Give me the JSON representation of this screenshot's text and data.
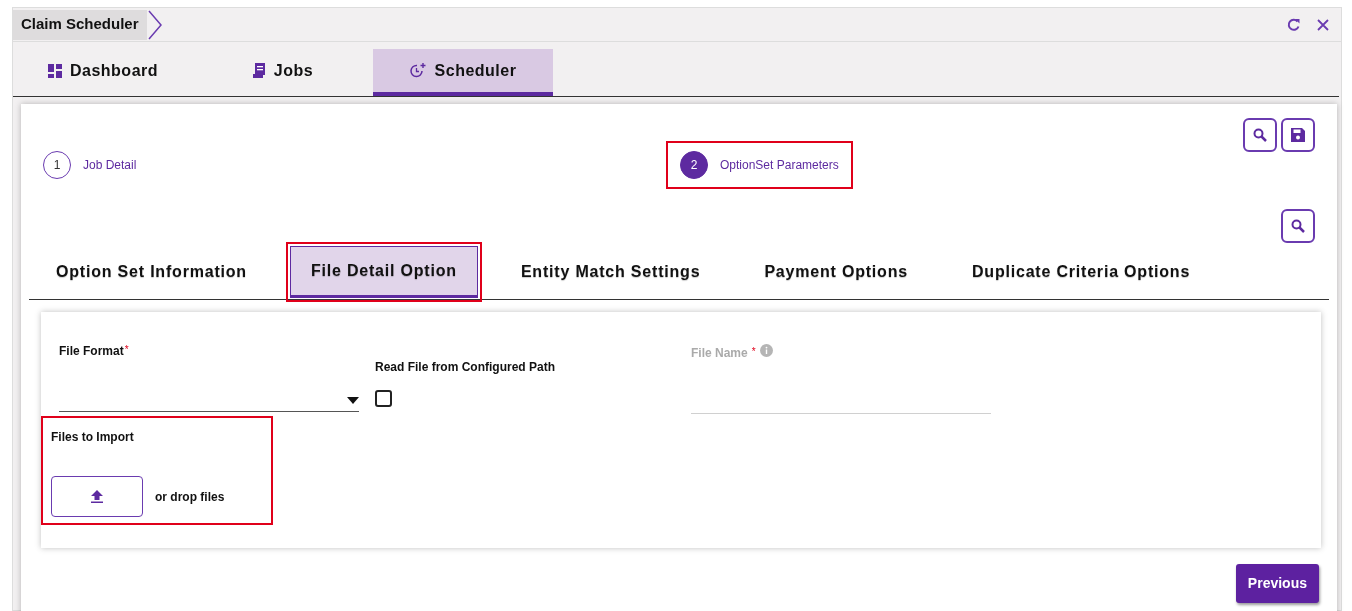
{
  "window": {
    "title": "Claim Scheduler"
  },
  "main_tabs": [
    {
      "label": "Dashboard",
      "selected": false
    },
    {
      "label": "Jobs",
      "selected": false
    },
    {
      "label": "Scheduler",
      "selected": true
    }
  ],
  "steps": [
    {
      "number": "1",
      "label": "Job Detail",
      "selected": false,
      "highlighted": false
    },
    {
      "number": "2",
      "label": "OptionSet Parameters",
      "selected": true,
      "highlighted": true
    }
  ],
  "option_tabs": [
    {
      "label": "Option Set Information",
      "selected": false,
      "highlighted": false
    },
    {
      "label": "File Detail Option",
      "selected": true,
      "highlighted": true
    },
    {
      "label": "Entity Match Settings",
      "selected": false,
      "highlighted": false
    },
    {
      "label": "Payment Options",
      "selected": false,
      "highlighted": false
    },
    {
      "label": "Duplicate Criteria Options",
      "selected": false,
      "highlighted": false
    }
  ],
  "form": {
    "file_format": {
      "label": "File Format",
      "required_mark": "*"
    },
    "read_from_path": {
      "label": "Read File from Configured Path",
      "checked": false
    },
    "file_name": {
      "label": "File Name",
      "required_mark": "*",
      "disabled": true
    },
    "files_to_import": {
      "label": "Files to Import",
      "drop_text": "or drop files",
      "highlighted": true
    }
  },
  "buttons": [
    {
      "label": "Previous"
    }
  ]
}
